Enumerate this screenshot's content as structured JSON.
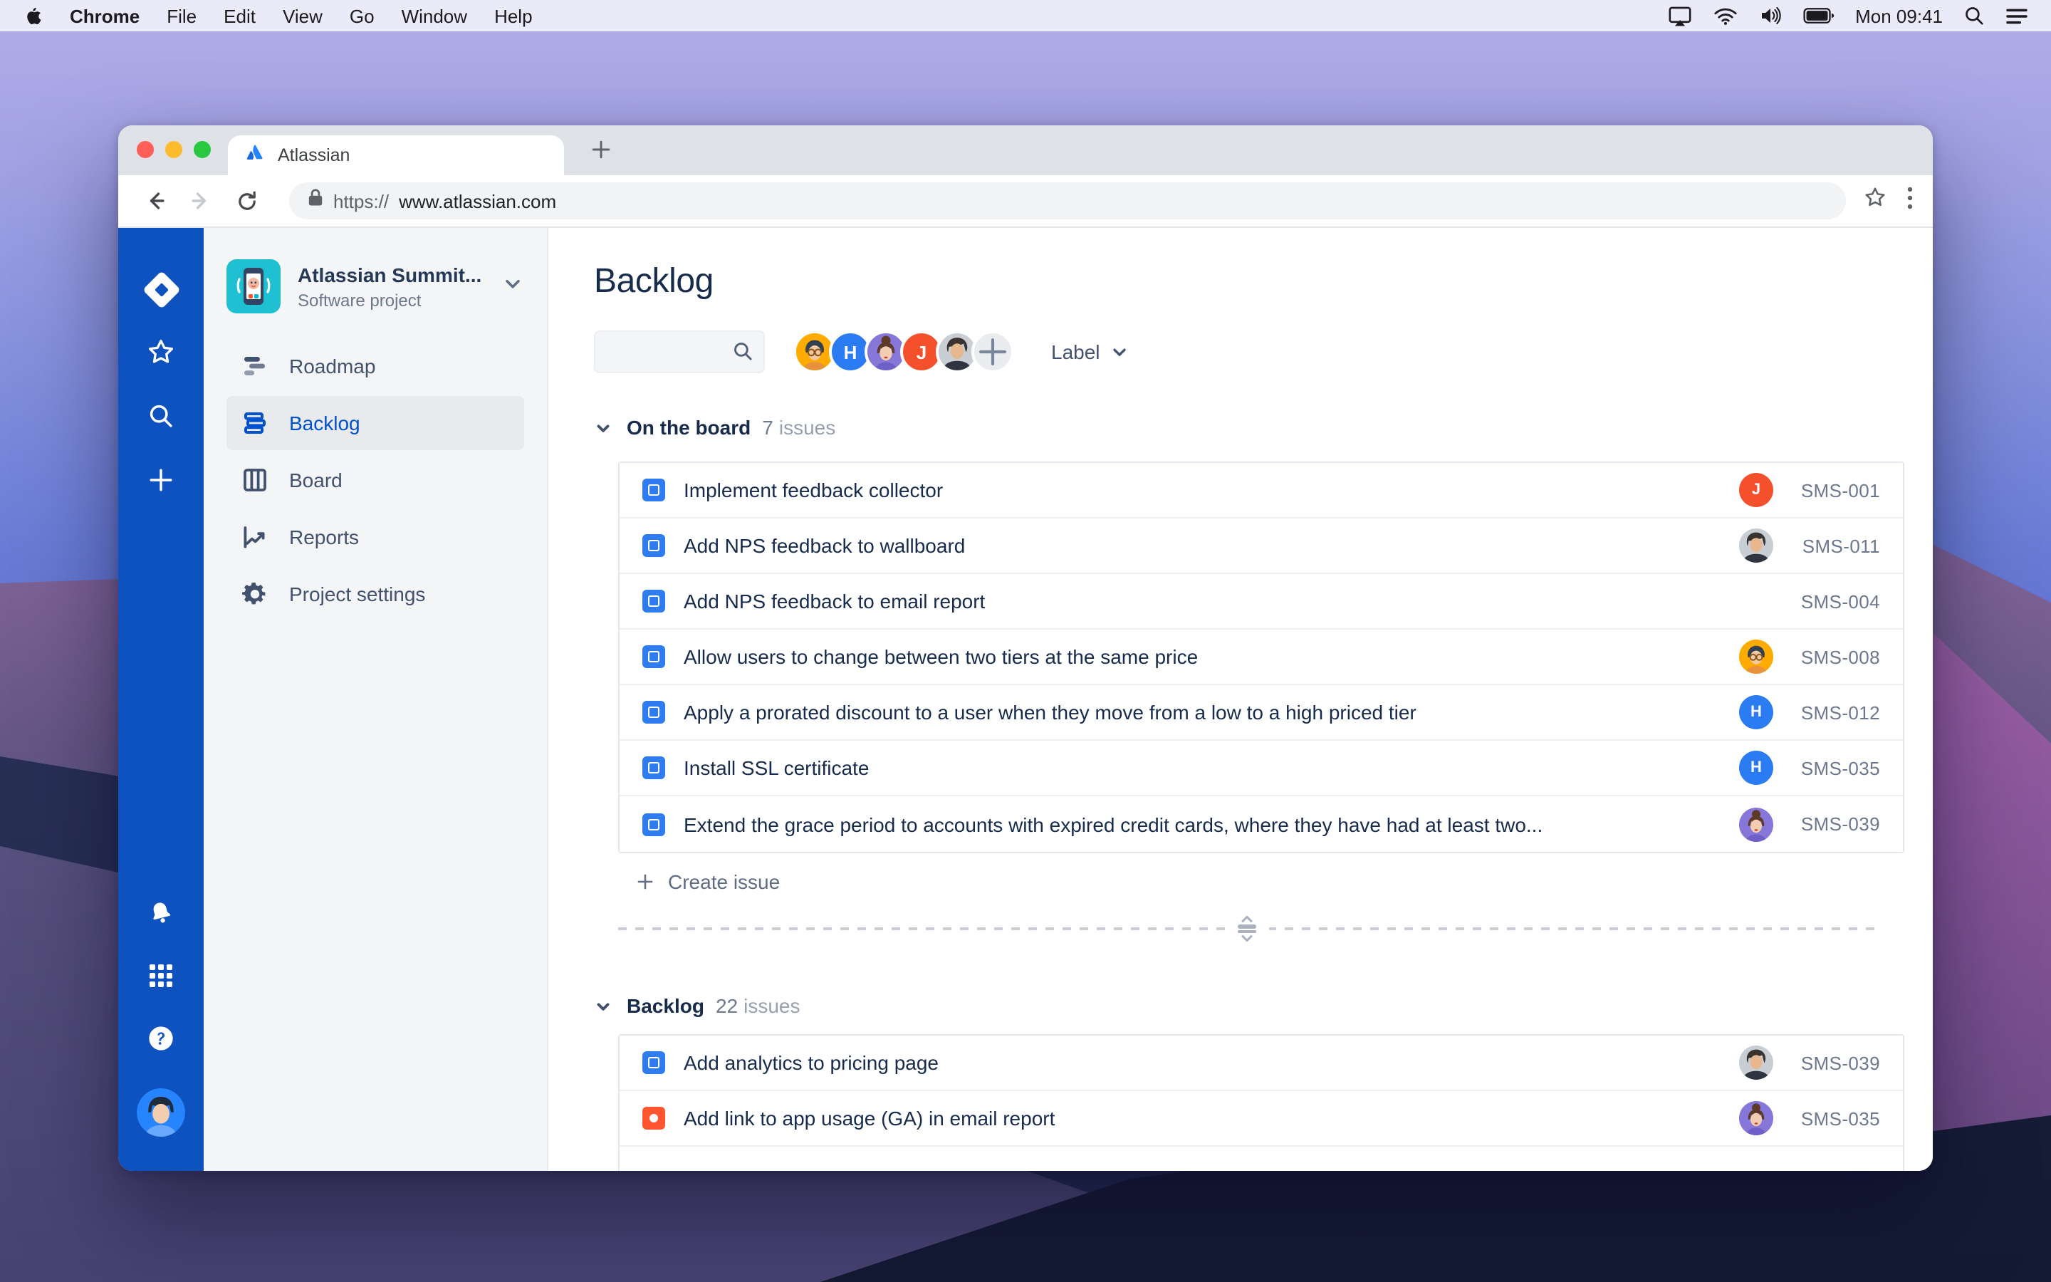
{
  "menu_bar": {
    "items": [
      "Chrome",
      "File",
      "Edit",
      "View",
      "Go",
      "Window",
      "Help"
    ],
    "clock": "Mon 09:41"
  },
  "browser": {
    "tab_title": "Atlassian",
    "url_scheme": "https://",
    "url_host": "www.atlassian.com"
  },
  "sidebar": {
    "project_name": "Atlassian Summit...",
    "project_type": "Software project",
    "items": [
      {
        "label": "Roadmap"
      },
      {
        "label": "Backlog"
      },
      {
        "label": "Board"
      },
      {
        "label": "Reports"
      },
      {
        "label": "Project settings"
      }
    ],
    "active_item": "Backlog"
  },
  "main": {
    "title": "Backlog",
    "label_filter": "Label",
    "create_issue_label": "Create issue",
    "members": {
      "h_initial": "H",
      "j_initial": "J"
    },
    "sections": [
      {
        "title": "On the board",
        "count": "7",
        "count_unit": "issues",
        "rows": [
          {
            "type": "story",
            "title": "Implement feedback collector",
            "key": "SMS-001",
            "avatar": "initial-red",
            "initial": "J"
          },
          {
            "type": "story",
            "title": "Add NPS feedback to wallboard",
            "key": "SMS-011",
            "avatar": "photo-man"
          },
          {
            "type": "story",
            "title": "Add NPS feedback to email report",
            "key": "SMS-004",
            "avatar": "none"
          },
          {
            "type": "story",
            "title": "Allow users to change between two tiers at the same price",
            "key": "SMS-008",
            "avatar": "cartoon-man-glasses"
          },
          {
            "type": "story",
            "title": "Apply a prorated discount to a user when they move from a low to a high priced tier",
            "key": "SMS-012",
            "avatar": "initial-blue",
            "initial": "H"
          },
          {
            "type": "story",
            "title": "Install SSL certificate",
            "key": "SMS-035",
            "avatar": "initial-blue",
            "initial": "H"
          },
          {
            "type": "story",
            "title": "Extend the grace period to accounts with expired credit cards, where they have had at least two...",
            "key": "SMS-039",
            "avatar": "cartoon-woman"
          }
        ]
      },
      {
        "title": "Backlog",
        "count": "22",
        "count_unit": "issues",
        "rows": [
          {
            "type": "story",
            "title": "Add analytics to pricing page",
            "key": "SMS-039",
            "avatar": "photo-man"
          },
          {
            "type": "bug",
            "title": "Add link to app usage (GA) in email report",
            "key": "SMS-035",
            "avatar": "cartoon-woman"
          }
        ]
      }
    ]
  },
  "colors": {
    "rail_blue": "#0d52bf",
    "active_nav_blue": "#0052cc",
    "story_icon_blue": "#2e7cf0",
    "bug_icon_red": "#ff5630",
    "avatar_orange": "#ffab00",
    "avatar_purple": "#8777d9",
    "avatar_blue": "#2b7bf3",
    "avatar_red": "#f4502c",
    "text_dark": "#172b4d",
    "text_gray": "#6b778c"
  }
}
